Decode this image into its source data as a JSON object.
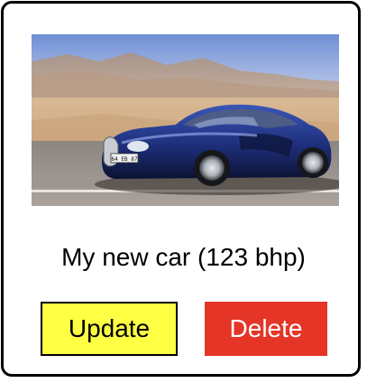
{
  "card": {
    "image_alt": "blue sports car",
    "title": "My new car (123 bhp)",
    "plate_text": "64 EB 87",
    "update_label": "Update",
    "delete_label": "Delete"
  },
  "colors": {
    "update_bg": "#ffff44",
    "delete_bg": "#e53527",
    "car_body": "#1e2f7a"
  }
}
